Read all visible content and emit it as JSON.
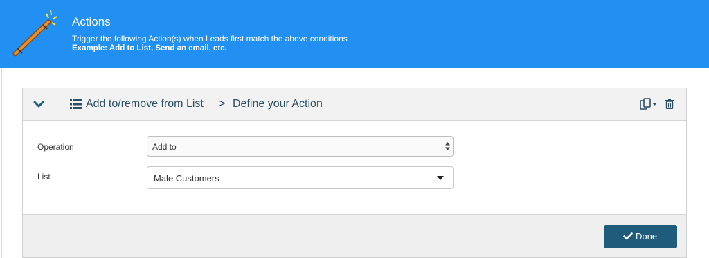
{
  "header": {
    "title": "Actions",
    "description": "Trigger the following Action(s) when Leads first match the above conditions",
    "example": "Example: Add to List, Send an email, etc.",
    "background_color": "#2190f2",
    "icon": "magic-wand-icon"
  },
  "action_card": {
    "breadcrumb": {
      "action_type": "Add to/remove from List",
      "separator": ">",
      "step": "Define your Action"
    },
    "icons": [
      "chevron-down-icon",
      "list-icon",
      "copy-icon",
      "caret-down-icon",
      "trash-icon"
    ],
    "fields": {
      "operation": {
        "label": "Operation",
        "value": "Add to"
      },
      "list": {
        "label": "List",
        "value": "Male Customers"
      }
    },
    "done_button": {
      "label": "Done",
      "icon": "check-icon",
      "color": "#1f5c7b"
    }
  }
}
